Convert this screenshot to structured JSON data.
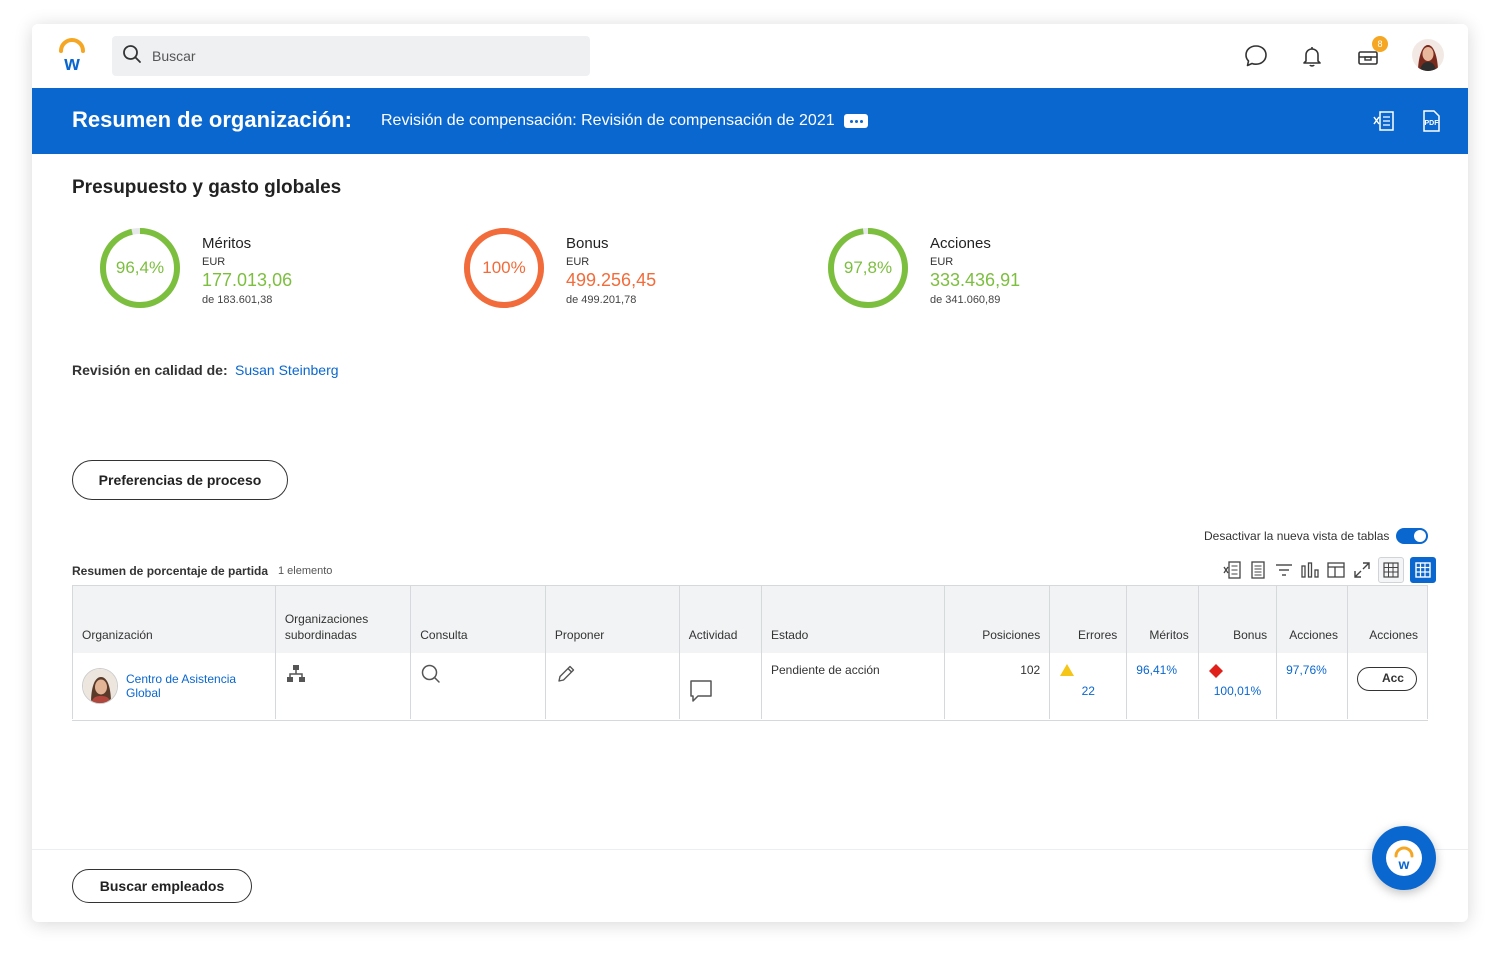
{
  "topbar": {
    "search_placeholder": "Buscar",
    "inbox_badge": "8",
    "icons": [
      "workday-logo-icon",
      "search-icon",
      "chat-icon",
      "bell-icon",
      "inbox-icon",
      "user-avatar"
    ]
  },
  "header": {
    "title": "Resumen de organización:",
    "subtitle": "Revisión de compensación: Revisión de compensación de 2021",
    "icons": [
      "more-options-icon",
      "export-excel-icon",
      "export-pdf-icon"
    ]
  },
  "budget": {
    "title": "Presupuesto y gasto globales",
    "metrics": [
      {
        "name": "Méritos",
        "percent_label": "96,4%",
        "percent": 96.4,
        "currency": "EUR",
        "amount": "177.013,06",
        "of": "de 183.601,38",
        "color": "#7cbf3f"
      },
      {
        "name": "Bonus",
        "percent_label": "100%",
        "percent": 100,
        "currency": "EUR",
        "amount": "499.256,45",
        "of": "de 499.201,78",
        "color": "#f26b3a"
      },
      {
        "name": "Acciones",
        "percent_label": "97,8%",
        "percent": 97.8,
        "currency": "EUR",
        "amount": "333.436,91",
        "of": "de 341.060,89",
        "color": "#7cbf3f"
      }
    ]
  },
  "review": {
    "label": "Revisión en calidad de:",
    "person": "Susan Steinberg"
  },
  "buttons": {
    "process_prefs": "Preferencias de proceso",
    "search_employees": "Buscar empleados"
  },
  "table": {
    "toggle_label": "Desactivar la nueva vista de tablas",
    "toggle_on": true,
    "title": "Resumen de porcentaje de partida",
    "count": "1 elemento",
    "columns": [
      "Organización",
      "Organizaciones subordinadas",
      "Consulta",
      "Proponer",
      "Actividad",
      "Estado",
      "Posiciones",
      "Errores",
      "Méritos",
      "Bonus",
      "Acciones",
      "Acciones"
    ],
    "rows": [
      {
        "organization": "Centro de Asistencia Global",
        "status": "Pendiente de acción",
        "positions": "102",
        "errors": "22",
        "merits": "96,41%",
        "bonus": "100,01%",
        "shares": "97,76%",
        "action_button": "Acc"
      }
    ]
  },
  "colors": {
    "brand_blue": "#0a67cf",
    "green": "#7cbf3f",
    "orange": "#f26b3a",
    "warning": "#f5c518",
    "error": "#e0201b"
  }
}
